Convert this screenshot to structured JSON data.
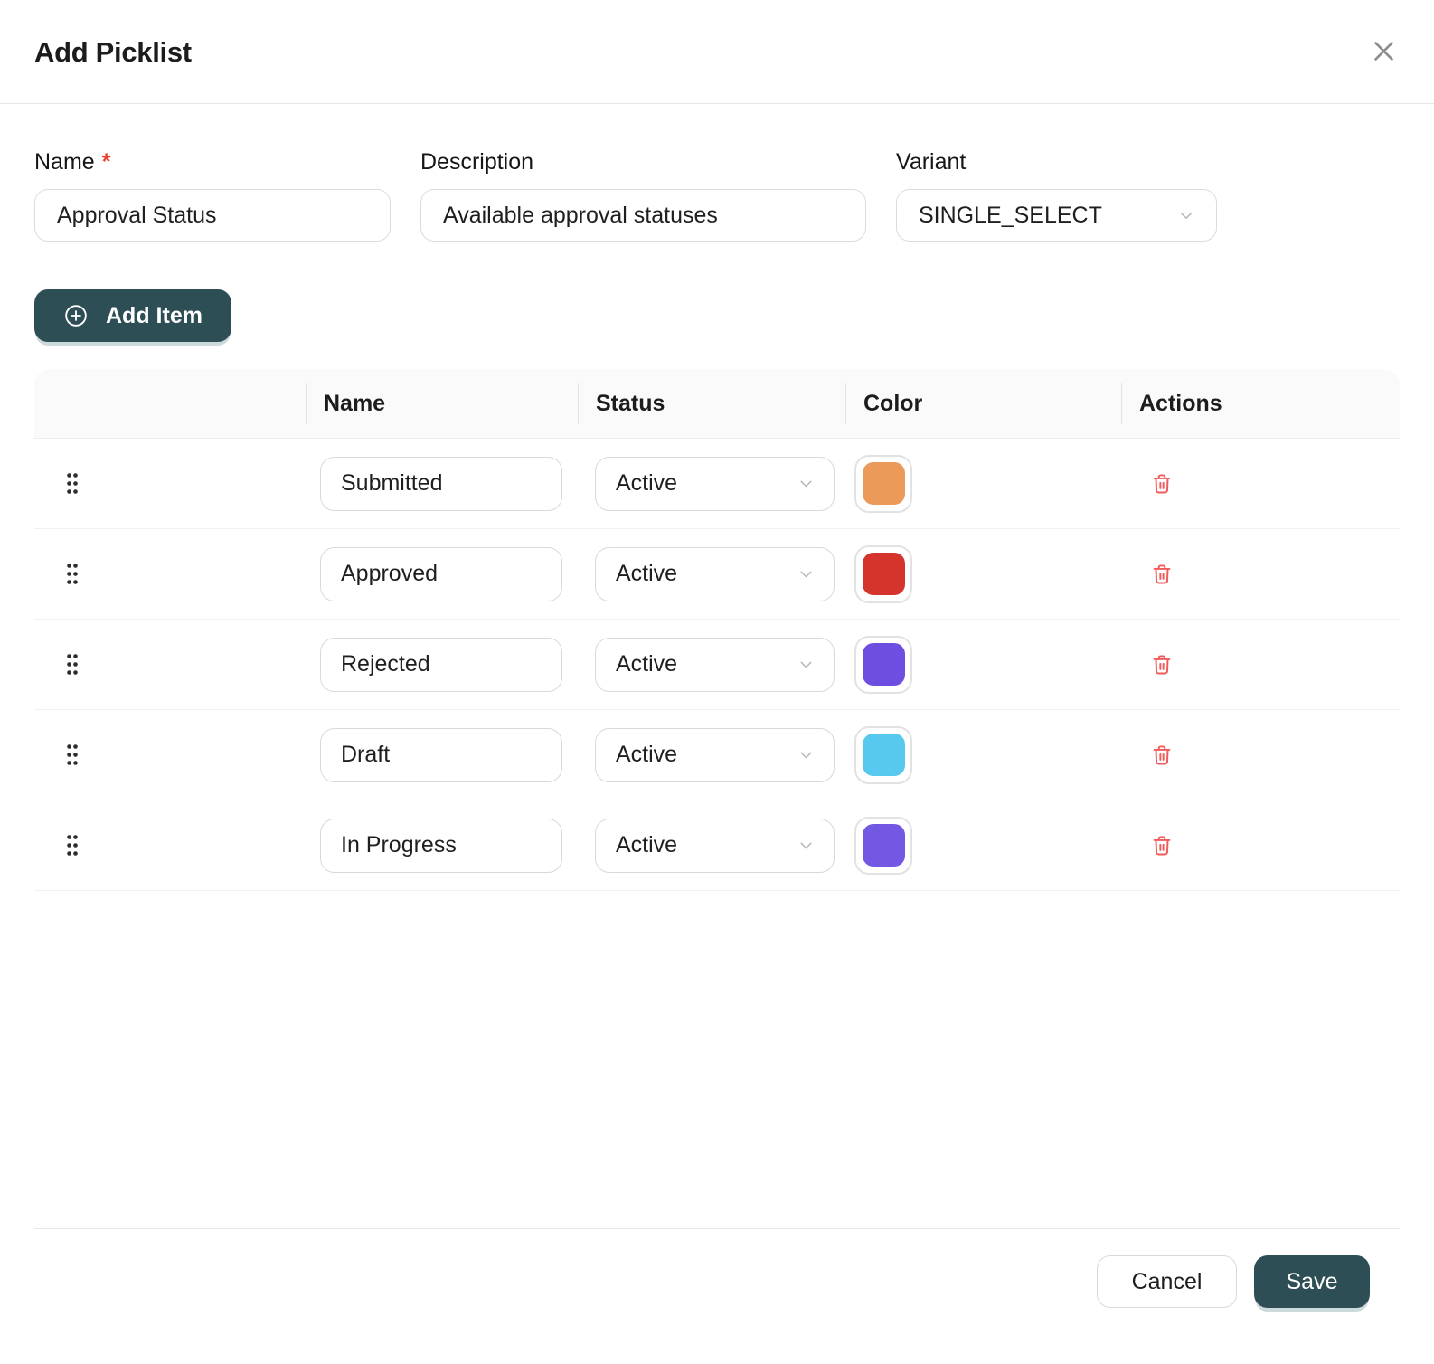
{
  "modal": {
    "title": "Add Picklist"
  },
  "form": {
    "name": {
      "label": "Name",
      "required_mark": "*",
      "value": "Approval Status"
    },
    "description": {
      "label": "Description",
      "value": "Available approval statuses"
    },
    "variant": {
      "label": "Variant",
      "value": "SINGLE_SELECT"
    }
  },
  "toolbar": {
    "add_item_label": "Add Item"
  },
  "table": {
    "columns": {
      "name": "Name",
      "status": "Status",
      "color": "Color",
      "actions": "Actions"
    },
    "rows": [
      {
        "name": "Submitted",
        "status": "Active",
        "color": "#ec9a59"
      },
      {
        "name": "Approved",
        "status": "Active",
        "color": "#d4342b"
      },
      {
        "name": "Rejected",
        "status": "Active",
        "color": "#6e4ee0"
      },
      {
        "name": "Draft",
        "status": "Active",
        "color": "#57c8ee"
      },
      {
        "name": "In Progress",
        "status": "Active",
        "color": "#7258e2"
      }
    ]
  },
  "footer": {
    "cancel_label": "Cancel",
    "save_label": "Save"
  },
  "icons": {
    "close": "x-icon",
    "add": "plus-circle-icon",
    "dropdown": "chevron-down-icon",
    "drag": "drag-dots-icon",
    "delete": "trash-icon"
  },
  "colors": {
    "primary": "#2d4e54",
    "danger": "#f15b5b",
    "required_asterisk": "#e8432f",
    "table_header_bg": "#fafafa"
  }
}
